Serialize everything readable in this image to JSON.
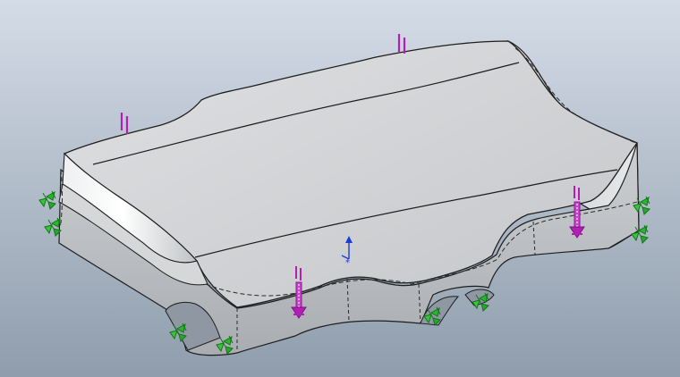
{
  "viewport": {
    "background_top": "#d4dce7",
    "background_bottom": "#8f9dac"
  },
  "model": {
    "face_color": "#cfd1d3",
    "side_color": "#b9bbbe",
    "edge_color": "#1e1e1e"
  },
  "annotations": {
    "load_color": "#b21fb5",
    "fixture_color": "#22a82a",
    "triad_color": "#1e3cd2",
    "parallel_markers": 2,
    "load_arrows": 3,
    "fixtures": 7
  },
  "icons": {
    "parallel": "parallel-relation-icon",
    "load": "force-arrow-icon",
    "fixture": "fixed-geometry-icon",
    "triad": "axis-triad-icon"
  }
}
